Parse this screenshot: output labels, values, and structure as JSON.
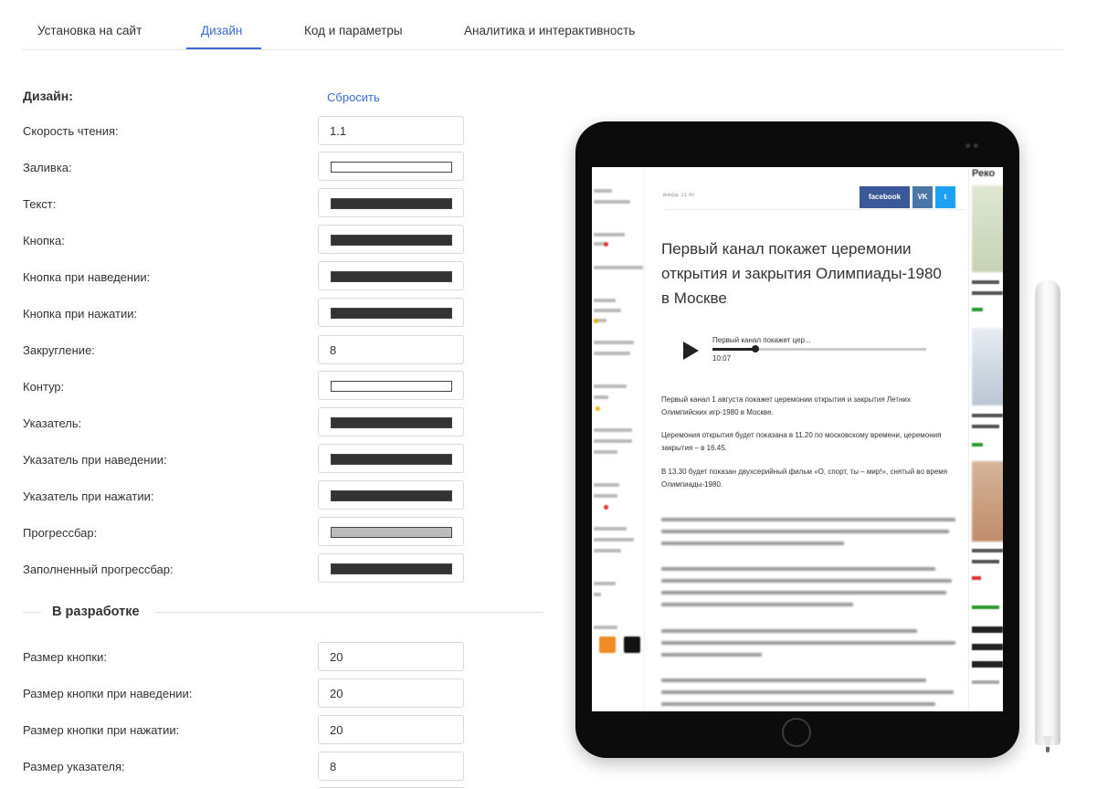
{
  "tabs": [
    {
      "label": "Установка на сайт"
    },
    {
      "label": "Дизайн"
    },
    {
      "label": "Код и параметры"
    },
    {
      "label": "Аналитика и интерактивность"
    }
  ],
  "design": {
    "title": "Дизайн:",
    "reset_label": "Сбросить",
    "fields": [
      {
        "label": "Скорость чтения:",
        "value": "1.1"
      },
      {
        "label": "Заливка:",
        "color": "#ffffff"
      },
      {
        "label": "Текст:",
        "color": "#333333"
      },
      {
        "label": "Кнопка:",
        "color": "#333333"
      },
      {
        "label": "Кнопка при наведении:",
        "color": "#333333"
      },
      {
        "label": "Кнопка при нажатии:",
        "color": "#333333"
      },
      {
        "label": "Закругление:",
        "value": "8"
      },
      {
        "label": "Контур:",
        "color": "#ffffff"
      },
      {
        "label": "Указатель:",
        "color": "#333333"
      },
      {
        "label": "Указатель при наведении:",
        "color": "#333333"
      },
      {
        "label": "Указатель при нажатии:",
        "color": "#333333"
      },
      {
        "label": "Прогрессбар:",
        "color": "#bbbbbb"
      },
      {
        "label": "Заполненный прогрессбар:",
        "color": "#333333"
      }
    ]
  },
  "dev": {
    "title": "В разработке",
    "fields": [
      {
        "label": "Размер кнопки:",
        "value": "20"
      },
      {
        "label": "Размер кнопки при наведении:",
        "value": "20"
      },
      {
        "label": "Размер кнопки при нажатии:",
        "value": "20"
      },
      {
        "label": "Размер указателя:",
        "value": "8"
      }
    ]
  },
  "preview": {
    "date": "вчера, 21:40",
    "share": {
      "facebook": "facebook",
      "vk": "VK",
      "twitter": "t"
    },
    "headline": "Первый канал покажет церемонии открытия и закрытия Олимпиады-1980 в Москве",
    "player": {
      "title": "Первый канал покажет цер...",
      "time": "10:07",
      "progress": 0.2
    },
    "paragraphs": [
      "Первый канал 1 августа покажет церемонии открытия и закрытия Летних Олимпийских игр-1980 в Москве.",
      "Церемония открытия будет показана в 11.20 по московскому времени, церемония закрытия – в 16.45.",
      "В 13.30 будет показан двухсерийный фильм «О, спорт, ты – мир!», снятый во время Олимпиады-1980."
    ],
    "right_heading": "Реко",
    "accent_colors": {
      "link": "#3b6bd6",
      "green": "#2e9a2e",
      "red": "#d9322b"
    }
  }
}
